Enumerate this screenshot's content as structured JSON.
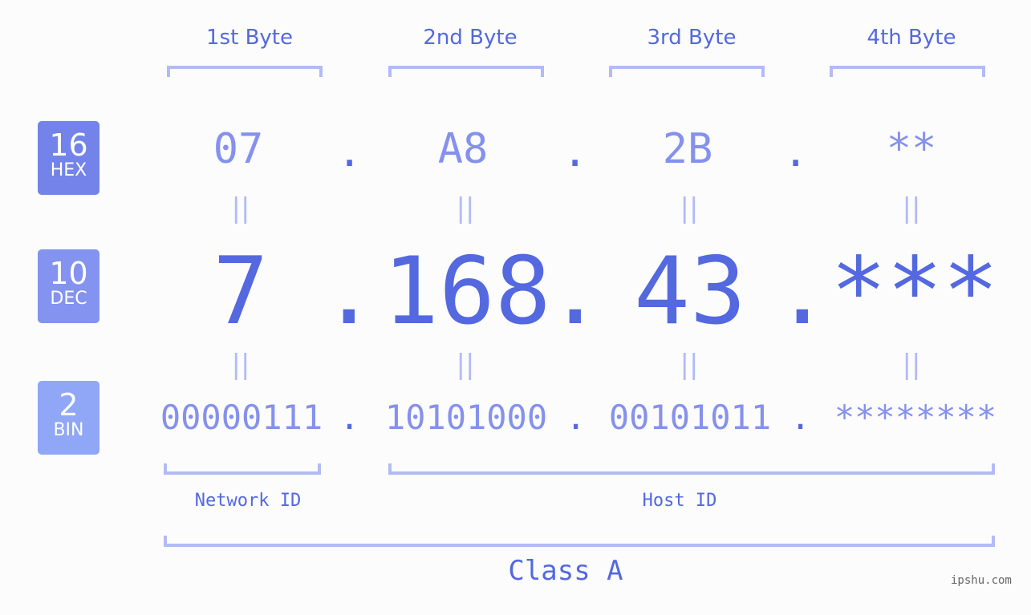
{
  "bytes": [
    {
      "heading": "1st Byte",
      "hex": "07",
      "dec": "7",
      "bin": "00000111"
    },
    {
      "heading": "2nd Byte",
      "hex": "A8",
      "dec": "168",
      "bin": "10101000"
    },
    {
      "heading": "3rd Byte",
      "hex": "2B",
      "dec": "43",
      "bin": "00101011"
    },
    {
      "heading": "4th Byte",
      "hex": "**",
      "dec": "***",
      "bin": "********"
    }
  ],
  "badges": {
    "hex": {
      "num": "16",
      "label": "HEX",
      "color": "#7383ea"
    },
    "dec": {
      "num": "10",
      "label": "DEC",
      "color": "#8393ef"
    },
    "bin": {
      "num": "2",
      "label": "BIN",
      "color": "#90a6f6"
    }
  },
  "separator": ".",
  "equals": "||",
  "network_label": "Network ID",
  "host_label": "Host ID",
  "class_label": "Class A",
  "watermark": "ipshu.com",
  "colors": {
    "accent": "#5468e0",
    "light": "#8591ec",
    "bracket": "#b3bbf6"
  }
}
